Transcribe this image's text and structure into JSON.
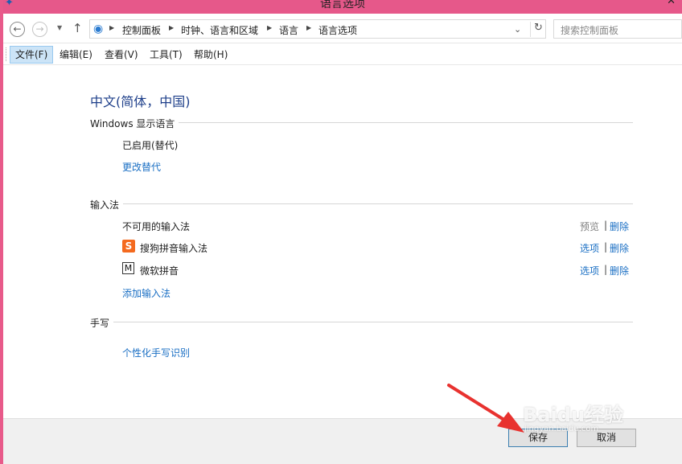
{
  "window": {
    "title": "语言选项",
    "close_glyph": "✕"
  },
  "address": {
    "crumbs": [
      "控制面板",
      "时钟、语言和区域",
      "语言",
      "语言选项"
    ],
    "search_placeholder": "搜索控制面板"
  },
  "menu": {
    "items": [
      "文件(F)",
      "编辑(E)",
      "查看(V)",
      "工具(T)",
      "帮助(H)"
    ]
  },
  "main": {
    "language_title": "中文(简体，中国)",
    "display_section": {
      "heading": "Windows 显示语言",
      "status": "已启用(替代)",
      "change_link": "更改替代"
    },
    "input_section": {
      "heading": "输入法",
      "methods": [
        {
          "name": "不可用的输入法",
          "icon": "none",
          "action1": "预览",
          "action2": "删除"
        },
        {
          "name": "搜狗拼音输入法",
          "icon": "sogou-icon",
          "icon_glyph": "S",
          "action1": "选项",
          "action2": "删除"
        },
        {
          "name": "微软拼音",
          "icon": "microsoft-pinyin-icon",
          "icon_glyph": "M",
          "action1": "选项",
          "action2": "删除"
        }
      ],
      "add_link": "添加输入法"
    },
    "handwriting_section": {
      "heading": "手写",
      "link": "个性化手写识别"
    }
  },
  "footer": {
    "save_label": "保存",
    "cancel_label": "取消"
  },
  "watermark": {
    "text": "Baidu经验",
    "sub": "jingyan.baidu.com"
  },
  "colors": {
    "title_bar": "#e6588a",
    "link": "#1a6fc4",
    "heading": "#1e3f8a",
    "annotation_arrow": "#e8322f"
  }
}
